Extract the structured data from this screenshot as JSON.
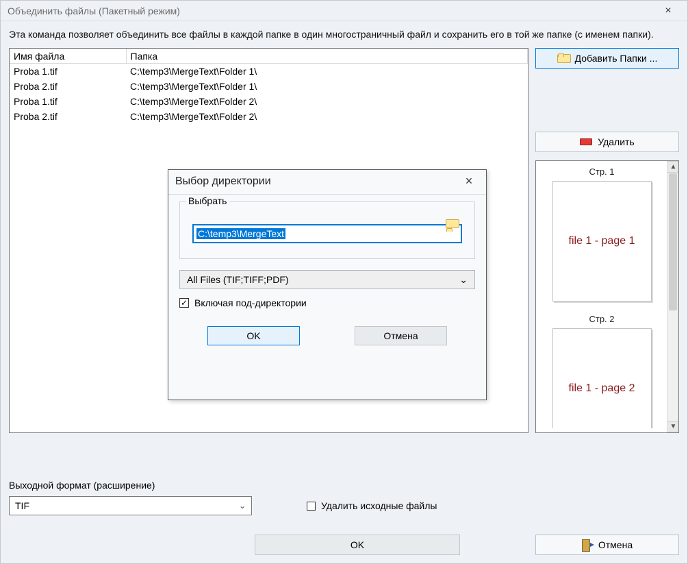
{
  "window": {
    "title": "Объединить файлы (Пакетный режим)",
    "description": "Эта команда позволяет объединить все файлы в каждой папке в один многостраничный файл и сохранить его в той же папке (с именем папки)."
  },
  "table": {
    "headers": {
      "name": "Имя файла",
      "folder": "Папка"
    },
    "rows": [
      {
        "name": "Proba 1.tif",
        "folder": "C:\\temp3\\MergeText\\Folder 1\\"
      },
      {
        "name": "Proba 2.tif",
        "folder": "C:\\temp3\\MergeText\\Folder 1\\"
      },
      {
        "name": "Proba 1.tif",
        "folder": "C:\\temp3\\MergeText\\Folder 2\\"
      },
      {
        "name": "Proba 2.tif",
        "folder": "C:\\temp3\\MergeText\\Folder 2\\"
      }
    ]
  },
  "sidebar": {
    "add_folders": "Добавить Папки ...",
    "delete": "Удалить",
    "preview": {
      "pages": [
        {
          "label": "Стр. 1",
          "content": "file 1 - page 1"
        },
        {
          "label": "Стр. 2",
          "content": "file 1 - page 2"
        }
      ]
    }
  },
  "bottom": {
    "output_format_label": "Выходной формат (расширение)",
    "output_format_value": "TIF",
    "delete_source_label": "Удалить исходные файлы",
    "delete_source_checked": false,
    "ok": "OK",
    "cancel": "Отмена"
  },
  "dialog": {
    "title": "Выбор директории",
    "group_label": "Выбрать",
    "path": "C:\\temp3\\MergeText",
    "filter": "All Files (TIF;TIFF;PDF)",
    "include_subdirs_label": "Включая под-директории",
    "include_subdirs_checked": true,
    "ok": "OK",
    "cancel": "Отмена"
  }
}
